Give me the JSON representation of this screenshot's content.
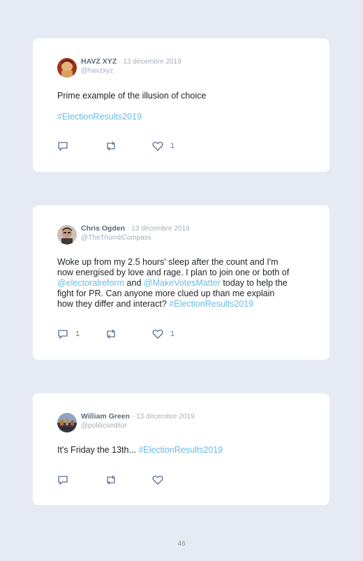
{
  "tweets": [
    {
      "name": "HAVZ XYZ",
      "date": "13 décembre 2019",
      "handle": "@havzxyz",
      "line1": "Prime example of the illusion of choice",
      "hashtag": "#ElectionResults2019",
      "replies": "",
      "retweets": "",
      "likes": "1"
    },
    {
      "name": "Chris Ogden",
      "date": "13 décembre 2019",
      "handle": "@TheThumbCompass",
      "lines": [
        "Woke up from my 2.5 hours' sleep after the count and I'm",
        "now energised by love and rage. I plan to join one or both of"
      ],
      "mention1": "@electoralreform",
      "and_text": " and ",
      "mention2": "@MakeVotesMatter",
      "today_text": " today to help the",
      "line4": "fight for PR. Can anyone more clued up than me explain",
      "line5": "how they differ and interact? ",
      "hashtag": "#ElectionResults2019",
      "replies": "1",
      "retweets": "",
      "likes": "1"
    },
    {
      "name": "William Green",
      "date": "13 décembre 2019",
      "handle": "@politicseditor",
      "text": "It's Friday the 13th... ",
      "hashtag": "#ElectionResults2019",
      "replies": "",
      "retweets": "",
      "likes": ""
    }
  ],
  "separator": "·",
  "page_number": "46",
  "colors": {
    "background": "#e6ebf3",
    "card": "#ffffff",
    "link": "#6bbbe5",
    "muted": "#a7b0bb",
    "name": "#5a6b7a"
  }
}
